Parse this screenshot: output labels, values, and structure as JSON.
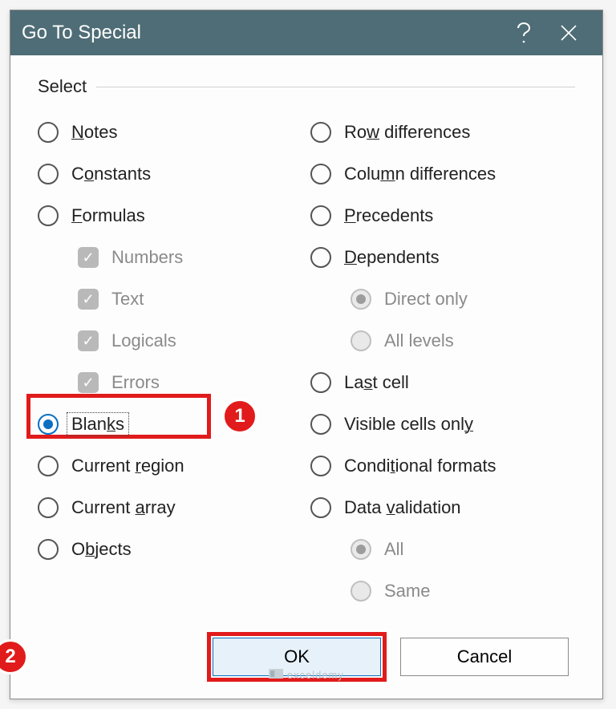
{
  "title": "Go To Special",
  "fieldset_label": "Select",
  "left": {
    "notes": "Notes",
    "constants": "Constants",
    "formulas": "Formulas",
    "numbers": "Numbers",
    "text": "Text",
    "logicals": "Logicals",
    "errors": "Errors",
    "blanks": "Blanks",
    "current_region": "Current region",
    "current_array": "Current array",
    "objects": "Objects"
  },
  "right": {
    "row_diff": "Row differences",
    "col_diff": "Column differences",
    "precedents": "Precedents",
    "dependents": "Dependents",
    "direct_only": "Direct only",
    "all_levels": "All levels",
    "last_cell": "Last cell",
    "visible": "Visible cells only",
    "cond_formats": "Conditional formats",
    "data_validation": "Data validation",
    "all": "All",
    "same": "Same"
  },
  "buttons": {
    "ok": "OK",
    "cancel": "Cancel"
  },
  "badges": {
    "one": "1",
    "two": "2"
  },
  "watermark": "exceldemy"
}
